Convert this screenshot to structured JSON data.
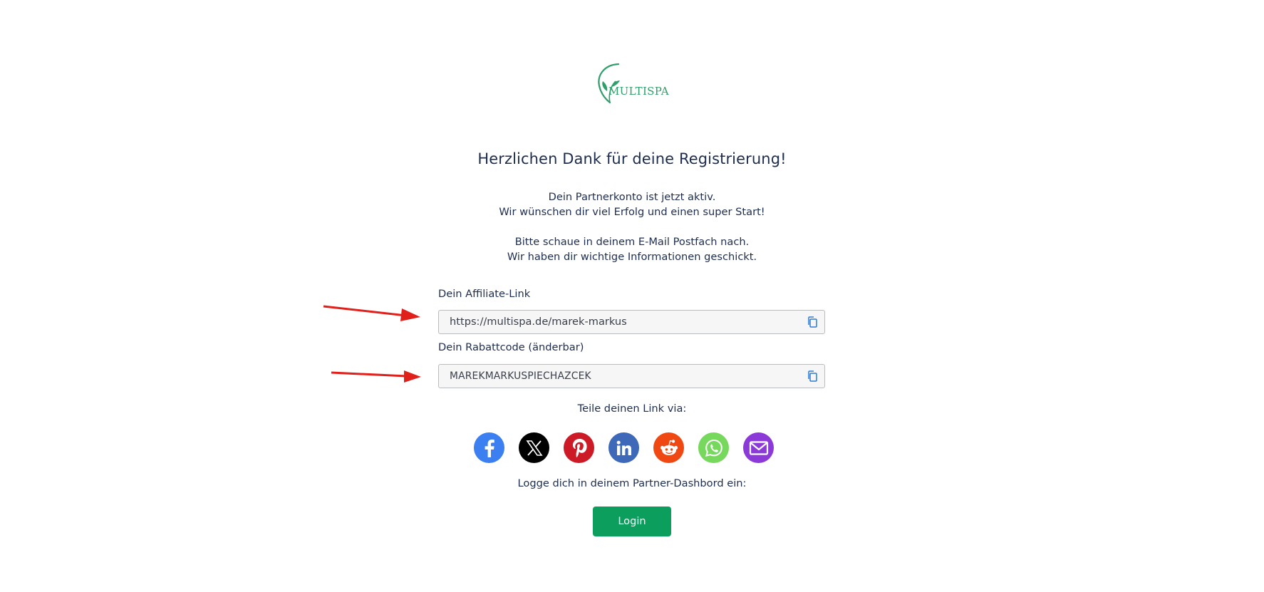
{
  "logo": {
    "text": "MULTISPA",
    "color": "#2f9e6a"
  },
  "heading": "Herzlichen Dank für deine Registrierung!",
  "intro": {
    "line1": "Dein Partnerkonto ist jetzt aktiv.",
    "line2": "Wir wünschen dir viel Erfolg und einen super Start!"
  },
  "email_note": {
    "line1": "Bitte schaue in deinem E-Mail Postfach nach.",
    "line2": "Wir haben dir wichtige Informationen geschickt."
  },
  "affiliate": {
    "label": "Dein Affiliate-Link",
    "value": "https://multispa.de/marek-markus"
  },
  "coupon": {
    "label": "Dein Rabattcode (änderbar)",
    "value": "MAREKMARKUSPIECHAZCEK"
  },
  "share": {
    "label": "Teile deinen Link via:",
    "networks": [
      {
        "name": "facebook",
        "icon": "facebook-icon",
        "color": "#3b7ff1"
      },
      {
        "name": "x",
        "icon": "x-icon",
        "color": "#000000"
      },
      {
        "name": "pinterest",
        "icon": "pinterest-icon",
        "color": "#cc1a27"
      },
      {
        "name": "linkedin",
        "icon": "linkedin-icon",
        "color": "#3e68b8"
      },
      {
        "name": "reddit",
        "icon": "reddit-icon",
        "color": "#f04812"
      },
      {
        "name": "whatsapp",
        "icon": "whatsapp-icon",
        "color": "#76d85c"
      },
      {
        "name": "email",
        "icon": "email-icon",
        "color": "#8b3ad8"
      }
    ]
  },
  "login": {
    "label": "Logge dich in deinem Partner-Dashbord ein:",
    "button": "Login",
    "button_color": "#0b9e5d"
  },
  "annotation_arrow_color": "#e0211b"
}
